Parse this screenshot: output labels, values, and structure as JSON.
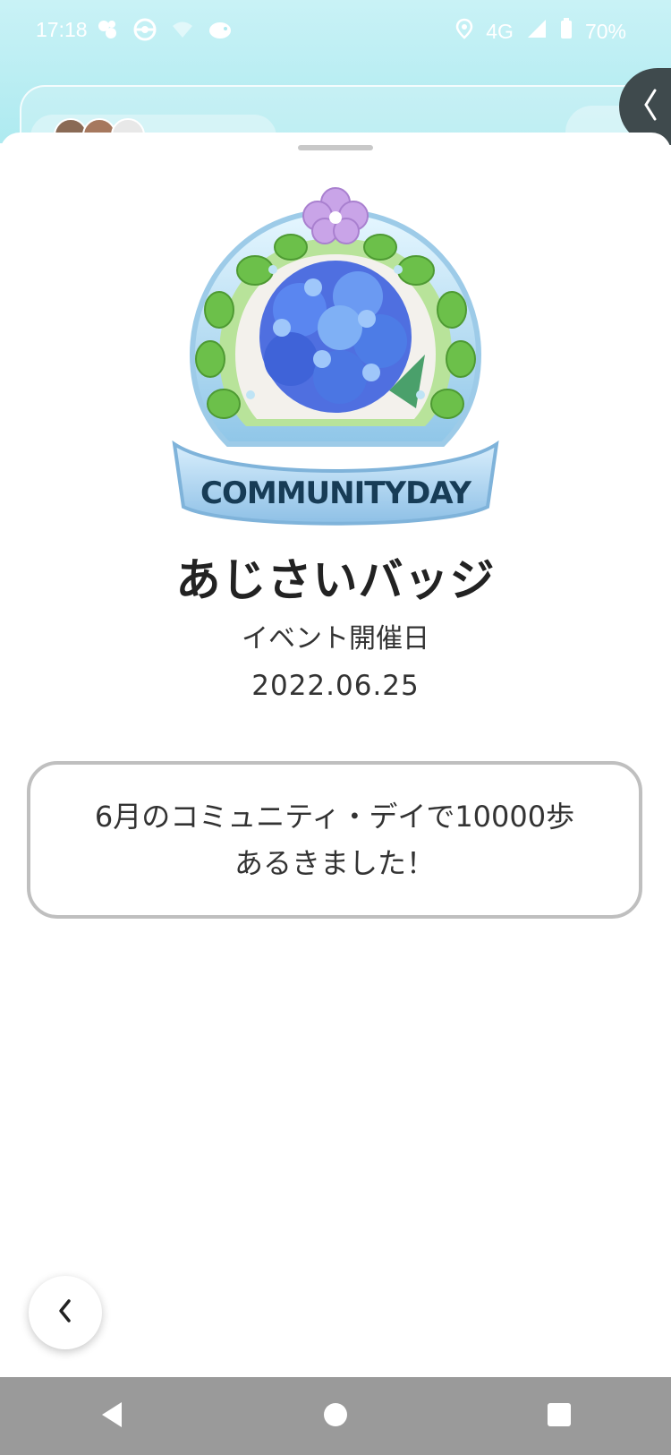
{
  "status_bar": {
    "time": "17:18",
    "network": "4G",
    "battery": "70%",
    "left_icons": [
      "pokemon-app-icon",
      "pokeball-icon",
      "wifi-off-icon",
      "app-notification-icon"
    ],
    "right_icons": [
      "location-icon",
      "signal-icon",
      "battery-icon"
    ]
  },
  "badge": {
    "title": "あじさいバッジ",
    "ribbon_text": "COMMUNITYDAY",
    "event_label": "イベント開催日",
    "event_date": "2022.06.25",
    "message_line1": "6月のコミュニティ・デイで10000歩",
    "message_line2": "あるきました！"
  },
  "colors": {
    "title": "#222222",
    "nav_bar": "#9a9a9a",
    "header_bg": "#aeeaf0"
  },
  "controls": {
    "back_icon": "chevron-left-icon",
    "side_tab_icon": "chevron-left-icon"
  },
  "nav_bar": {
    "buttons": [
      "back-triangle-icon",
      "home-circle-icon",
      "recents-square-icon"
    ]
  }
}
